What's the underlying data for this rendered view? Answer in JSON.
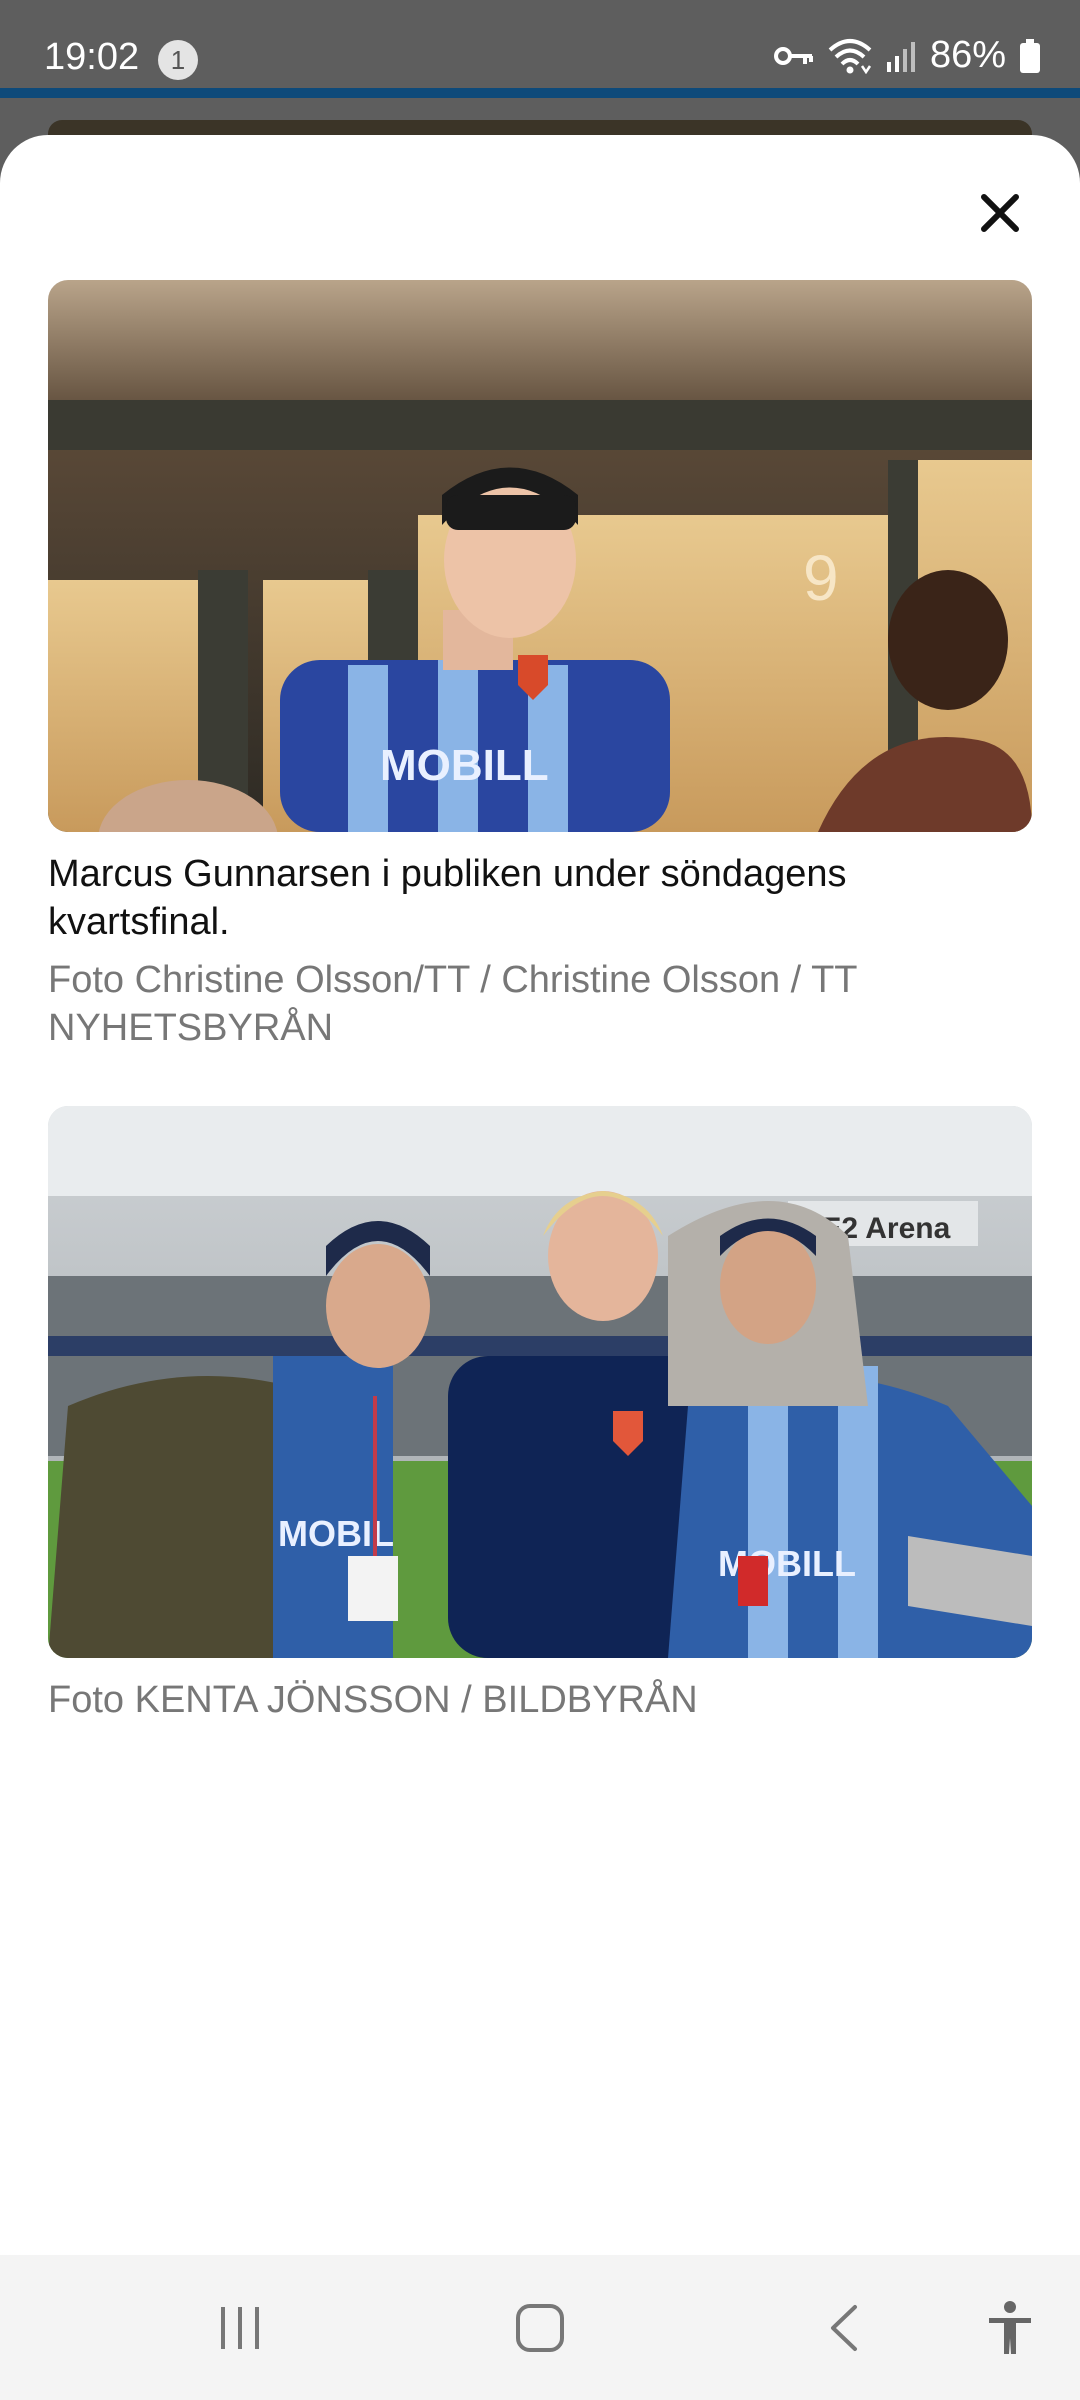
{
  "status_bar": {
    "time": "19:02",
    "notification_count": "1",
    "battery_percent": "86%",
    "icons": [
      "vpn-key-icon",
      "wifi-icon",
      "signal-icon",
      "battery-icon"
    ]
  },
  "modal": {
    "close_icon": "close-icon",
    "items": [
      {
        "caption": "Marcus Gunnarsen i publiken under söndagens kvartsfinal.",
        "credit": "Foto Christine Olsson/TT / Christine Olsson / TT NYHETSBYRÅN",
        "photo": "stadium-spectator-photo",
        "shirt_text": "MOBILL"
      },
      {
        "credit": "Foto KENTA JÖNSSON / BILDBYRÅN",
        "photo": "three-fans-pitch-photo",
        "arena_sign": "LE2 Arena",
        "shirt_text": "MOBILL"
      }
    ]
  },
  "nav_bar": {
    "icons": [
      "recent-apps-icon",
      "home-icon",
      "back-icon",
      "accessibility-icon"
    ]
  },
  "colors": {
    "status_bar_bg": "#5e5e5e",
    "accent_line": "#0e4a7a",
    "sheet_bg": "#ffffff",
    "caption_text": "#111111",
    "credit_text": "#777777",
    "nav_bar_bg": "#f4f4f4"
  }
}
